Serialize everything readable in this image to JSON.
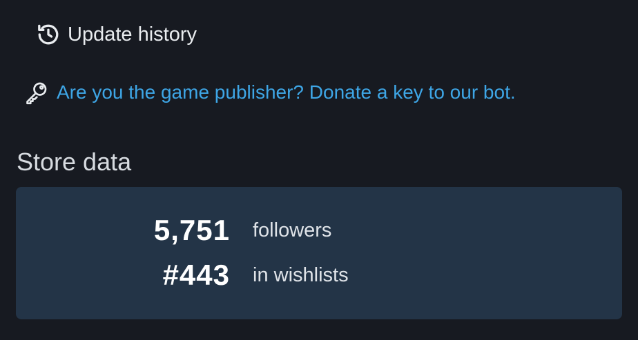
{
  "update_history": {
    "label": "Update history",
    "icon": "history-icon"
  },
  "publisher_link": {
    "text": "Are you the game publisher? Donate a key to our bot.",
    "icon": "key-icon",
    "color": "#3ea6e6"
  },
  "store_data": {
    "title": "Store data",
    "stats": [
      {
        "value": "5,751",
        "label": "followers"
      },
      {
        "value": "#443",
        "label": "in wishlists"
      }
    ]
  },
  "colors": {
    "background": "#171a21",
    "card": "#233447",
    "text": "#e9ecef"
  }
}
